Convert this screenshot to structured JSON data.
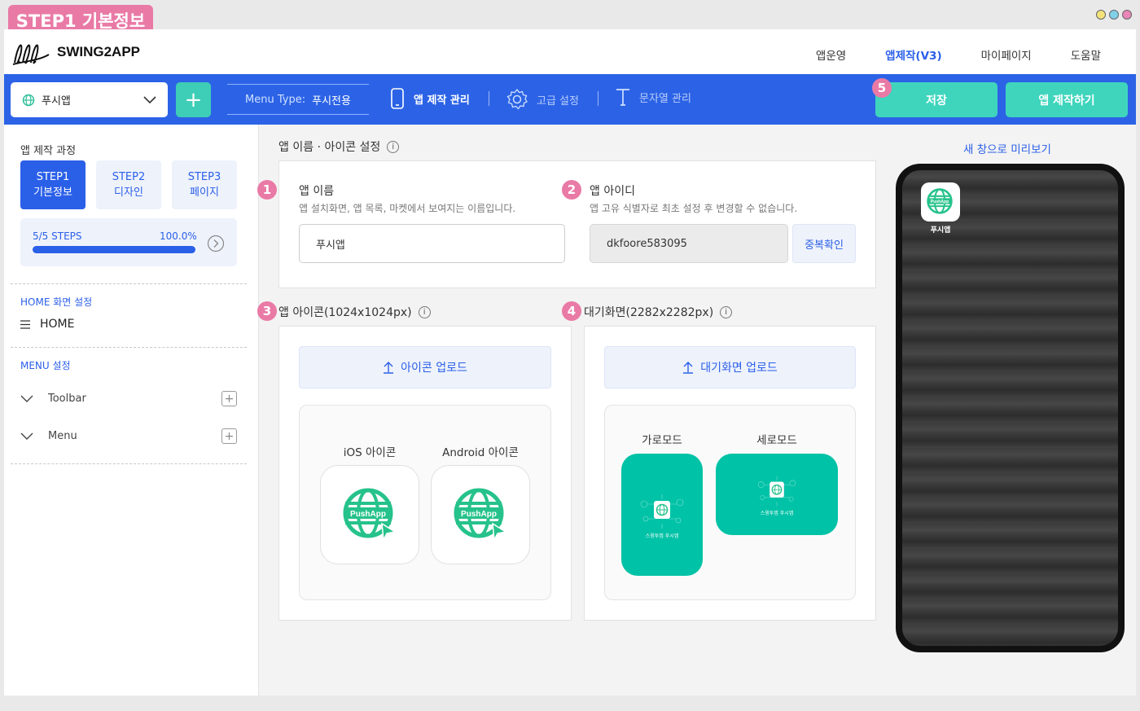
{
  "step_tag": "STEP1 기본정보",
  "logo": {
    "text": "SWING2APP"
  },
  "nav": {
    "items": [
      "앱운영",
      "앱제작(V3)",
      "마이페이지",
      "도움말"
    ],
    "active_index": 1
  },
  "toolbar": {
    "app_select": "푸시앱",
    "add": "+",
    "menu_type_label": "Menu Type:",
    "menu_type_value": "푸시전용",
    "app_manage": "앱 제작 관리",
    "advanced": "고급 설정",
    "strings": "문자열 관리",
    "save": "저장",
    "build": "앱 제작하기",
    "badge5": "5"
  },
  "sidebar": {
    "title": "앱 제작 과정",
    "steps": [
      {
        "line1": "STEP1",
        "line2": "기본정보"
      },
      {
        "line1": "STEP2",
        "line2": "디자인"
      },
      {
        "line1": "STEP3",
        "line2": "페이지"
      }
    ],
    "progress_label": "5/5 STEPS",
    "progress_percent": "100.0%",
    "progress_value": 1.0,
    "home_section": "HOME 화면 설정",
    "home_item": "HOME",
    "menu_section": "MENU 설정",
    "menu_items": [
      "Toolbar",
      "Menu"
    ]
  },
  "main": {
    "name_section_title": "앱 이름 · 아이콘 설정",
    "badges": [
      "1",
      "2",
      "3",
      "4"
    ],
    "app_name_label": "앱 이름",
    "app_name_desc": "앱 설치화면, 앱 목록, 마켓에서 보여지는 이름입니다.",
    "app_name_value": "푸시앱",
    "app_id_label": "앱 아이디",
    "app_id_desc": "앱 고유 식별자로 최초 설정 후 변경할 수 없습니다.",
    "app_id_value": "dkfoore583095",
    "dup_check": "중복확인",
    "icon_section": "앱 아이콘(1024x1024px)",
    "splash_section": "대기화면(2282x2282px)",
    "icon_upload": "아이콘 업로드",
    "splash_upload": "대기화면 업로드",
    "ios_icon": "iOS 아이콘",
    "android_icon": "Android 아이콘",
    "landscape": "가로모드",
    "portrait": "세로모드",
    "pushapp_text": "PushApp",
    "splash_caption": "스윙투앱 푸시앱"
  },
  "preview": {
    "link": "새 창으로 미리보기",
    "app_label": "푸시앱"
  },
  "colors": {
    "primary": "#2c63e6",
    "accent": "#3fd5bd",
    "pink": "#e97aa6",
    "splash": "#00c2a6"
  }
}
